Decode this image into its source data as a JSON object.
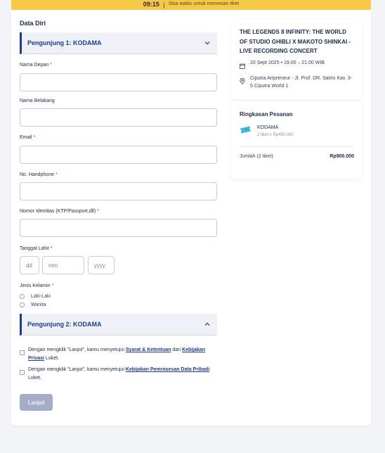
{
  "timer_bar": {
    "time": "09:15",
    "message": "Sisa waktu untuk memesan tiket"
  },
  "form": {
    "section_title": "Data Diri",
    "visitor1_label": "Pengunjung 1: KODAMA",
    "visitor2_label": "Pengunjung 2: KODAMA",
    "fields": {
      "first_name": "Nama Depan",
      "last_name": "Nama Belakang",
      "email": "Email",
      "phone": "No. Handphone",
      "id_number": "Nomor Identitas (KTP/Passport,dll)",
      "birthdate": "Tanggal Lahir",
      "gender": "Jenis Kelamin"
    },
    "required_mark": "*",
    "birthdate_placeholders": {
      "day": "dd",
      "month": "mm",
      "year": "yyyy"
    },
    "gender_options": [
      "Laki-Laki",
      "Wanita"
    ],
    "consent1": {
      "prefix": "Dengan mengklik \"Lanjut\", kamu menyetujui",
      "link1": "Syarat & Ketentuan",
      "mid": "dan",
      "link2": "Kebijakan Privasi",
      "suffix": "Loket."
    },
    "consent2": {
      "prefix": "Dengan mengklik \"Lanjut\", kamu menyetujui",
      "link": "Kebijakan Pemrosesan Data Pribadi",
      "suffix": "Loket."
    },
    "submit_label": "Lanjut"
  },
  "event": {
    "title": "THE LEGENDS 8 INFINITY: THE WORLD OF STUDIO GHIBLI X MAKOTO SHINKAI - LIVE RECORDING CONCERT",
    "datetime": "20 Sept 2025 • 19.00 – 21.00 WIB",
    "venue": "Ciputra Artpreneur - Jl. Prof. DR. Satrio Kav. 3-5 Ciputra World 1"
  },
  "summary": {
    "title": "Ringkasan Pesanan",
    "ticket_name": "KODAMA",
    "ticket_detail": "2 tiket x Rp450.000",
    "total_label": "Jumlah (2 tiket)",
    "total_value": "Rp900.000"
  },
  "colors": {
    "accent": "#1c3b8a",
    "timer_bar": "#f7c948",
    "required": "#e11d48",
    "button_disabled": "#a3aec6",
    "ticket_icon": "#2fb5d6"
  },
  "icons": {
    "chevron_down": "chevron-down-icon",
    "chevron_up": "chevron-up-icon",
    "calendar": "calendar-icon",
    "location": "location-pin-icon",
    "ticket": "ticket-icon"
  }
}
